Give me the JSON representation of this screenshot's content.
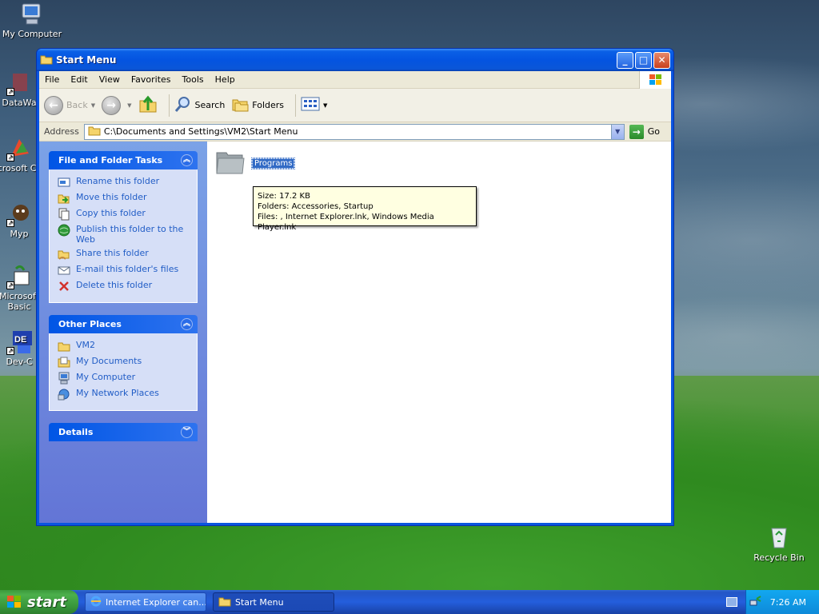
{
  "desktop": {
    "icons": [
      {
        "label": "My Computer"
      },
      {
        "label": "DataWa"
      },
      {
        "label": "Microsoft C++"
      },
      {
        "label": "Myp"
      },
      {
        "label": "Microsoft Basic"
      },
      {
        "label": "Dev-C"
      }
    ],
    "recycle_bin": "Recycle Bin"
  },
  "window": {
    "title": "Start Menu",
    "menu": [
      "File",
      "Edit",
      "View",
      "Favorites",
      "Tools",
      "Help"
    ],
    "toolbar": {
      "back": "Back",
      "search": "Search",
      "folders": "Folders"
    },
    "address": {
      "label": "Address",
      "value": "C:\\Documents and Settings\\VM2\\Start Menu",
      "go": "Go"
    },
    "task_pane": {
      "file_tasks": {
        "title": "File and Folder Tasks",
        "items": [
          {
            "label": "Rename this folder",
            "icon": "rename-icon"
          },
          {
            "label": "Move this folder",
            "icon": "move-icon"
          },
          {
            "label": "Copy this folder",
            "icon": "copy-icon"
          },
          {
            "label": "Publish this folder to the Web",
            "icon": "publish-web-icon"
          },
          {
            "label": "Share this folder",
            "icon": "share-icon"
          },
          {
            "label": "E-mail this folder's files",
            "icon": "email-icon"
          },
          {
            "label": "Delete this folder",
            "icon": "delete-icon"
          }
        ]
      },
      "other_places": {
        "title": "Other Places",
        "items": [
          {
            "label": "VM2",
            "icon": "folder-icon"
          },
          {
            "label": "My Documents",
            "icon": "my-documents-icon"
          },
          {
            "label": "My Computer",
            "icon": "my-computer-icon"
          },
          {
            "label": "My Network Places",
            "icon": "network-places-icon"
          }
        ]
      },
      "details": {
        "title": "Details"
      }
    },
    "content": {
      "folder": "Programs",
      "tooltip": {
        "size": "Size: 17.2 KB",
        "folders": "Folders: Accessories, Startup",
        "files": "Files: , Internet Explorer.lnk, Windows Media Player.lnk"
      }
    }
  },
  "taskbar": {
    "start": "start",
    "buttons": [
      {
        "label": "Internet Explorer can..."
      },
      {
        "label": "Start Menu"
      }
    ],
    "clock": "7:26 AM"
  },
  "colors": {
    "xp_blue": "#0a55e0",
    "task_link": "#215dc6",
    "selection": "#316ac5",
    "tooltip_bg": "#ffffe1",
    "start_green": "#3c9a3c"
  }
}
